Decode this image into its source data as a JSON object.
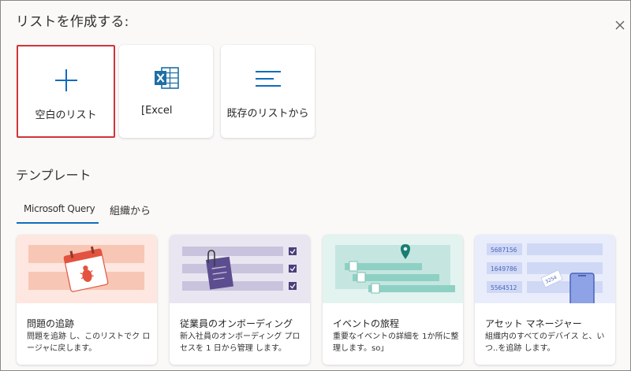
{
  "dialog": {
    "title": "リストを作成する:",
    "close_icon": "close-icon"
  },
  "create_options": [
    {
      "label": "空白のリスト",
      "icon": "plus-icon",
      "selected": true
    },
    {
      "label": "[Excel",
      "icon": "excel-icon",
      "selected": false
    },
    {
      "label": "既存のリストから",
      "icon": "list-lines-icon",
      "selected": false
    }
  ],
  "templates_section": {
    "title": "テンプレート",
    "tabs": [
      {
        "label": "Microsoft Query",
        "active": true
      },
      {
        "label": "組織から",
        "active": false
      }
    ],
    "cards": [
      {
        "name": "問題の追跡",
        "description": "問題を追跡 し、このリストでク ロージャに戻します。",
        "thumb_color": "#fce4dc"
      },
      {
        "name": "従業員のオンボーディング",
        "description": "新入社員のオンボーディング プロセスを 1 日から管理 します。",
        "thumb_color": "#e6e3ef",
        "thumb_labels": []
      },
      {
        "name": "イベントの旅程",
        "description": "重要なイベントの詳細を 1か所に整理します。so」",
        "thumb_color": "#e0f2ef"
      },
      {
        "name": "アセット マネージャー",
        "description": "組織内のすべてのデバイス と、いつ..を追跡 します。",
        "thumb_color": "#e8ecfa",
        "thumb_labels": [
          "5687156",
          "1649786",
          "5564512",
          "3254"
        ]
      }
    ]
  },
  "colors": {
    "accent": "#0f6cbd",
    "selected_border": "#d13438",
    "excel_green": "#1d6fa5"
  }
}
